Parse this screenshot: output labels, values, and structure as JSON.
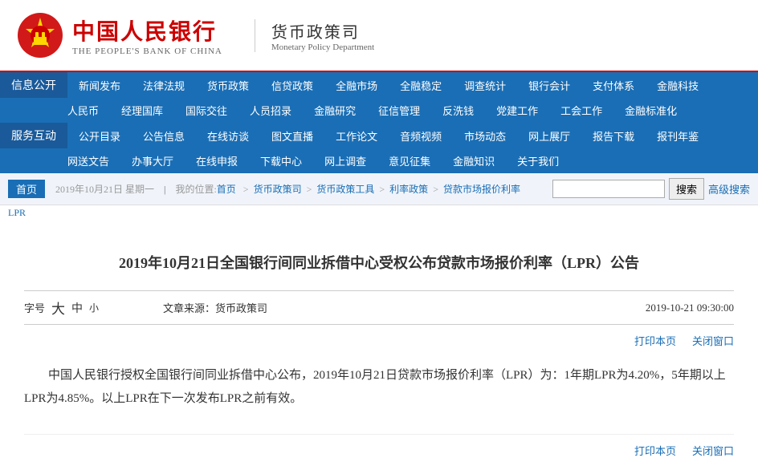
{
  "header": {
    "logo_cn": "中国人民银行",
    "logo_en": "THE PEOPLE'S BANK OF CHINA",
    "dept_cn": "货币政策司",
    "dept_en": "Monetary Policy Department"
  },
  "nav": {
    "section1_label": "信息公开",
    "section2_label": "服务互动",
    "row1": [
      "新闻发布",
      "法律法规",
      "货币政策",
      "信贷政策",
      "全融市场",
      "全融稳定",
      "调查统计",
      "银行会计",
      "支付体系",
      "金融科技"
    ],
    "row2": [
      "人民币",
      "经理国库",
      "国际交往",
      "人员招录",
      "金融研究",
      "征信管理",
      "反洗钱",
      "党建工作",
      "工会工作",
      "金融标准化"
    ],
    "row3": [
      "公开目录",
      "公告信息",
      "在线访谈",
      "图文直播",
      "工作论文",
      "音频视频",
      "市场动态",
      "网上展厅",
      "报告下载",
      "报刊年鉴"
    ],
    "row4": [
      "网送文告",
      "办事大厅",
      "在线申报",
      "下载中心",
      "网上调查",
      "意见征集",
      "金融知识",
      "关于我们"
    ]
  },
  "breadcrumb": {
    "home": "首页",
    "date": "2019年10月21日 星期一",
    "location_label": "我的位置:首页",
    "path": [
      "货币政策司",
      "货币政策工具",
      "利率政策",
      "贷款市场报价利率"
    ],
    "current": "LPR",
    "search_placeholder": "",
    "search_btn": "搜索",
    "adv_search": "高级搜索"
  },
  "article": {
    "title": "2019年10月21日全国银行间同业拆借中心受权公布贷款市场报价利率（LPR）公告",
    "font_size_label": "字号",
    "font_large": "大",
    "font_medium": "中",
    "font_small": "小",
    "source_label": "文章来源：",
    "source": "货币政策司",
    "date": "2019-10-21  09:30:00",
    "print_label": "打印本页",
    "close_label": "关闭窗口",
    "body": "中国人民银行授权全国银行间同业拆借中心公布，2019年10月21日贷款市场报价利率（LPR）为：1年期LPR为4.20%，5年期以上LPR为4.85%。以上LPR在下一次发布LPR之前有效。"
  }
}
